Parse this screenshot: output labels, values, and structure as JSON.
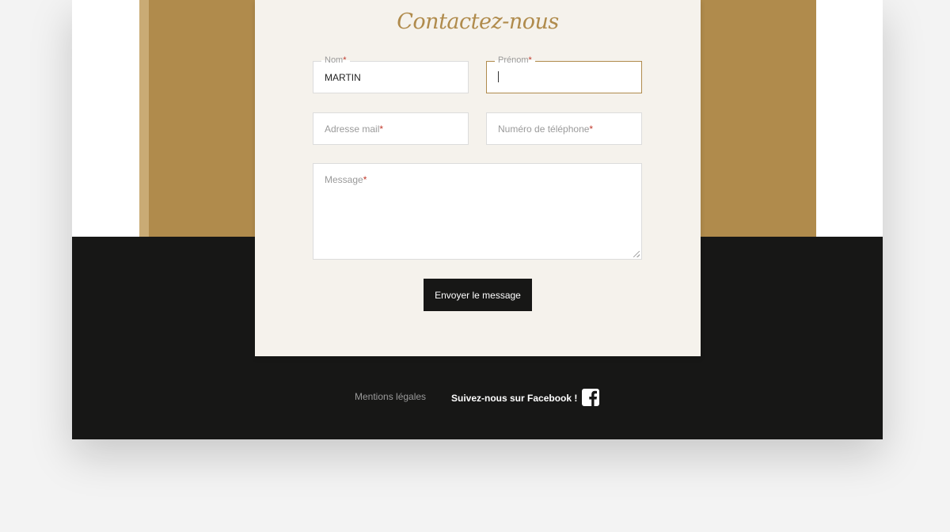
{
  "contact": {
    "title": "Contactez-nous",
    "required_marker": "*",
    "fields": {
      "nom": {
        "label": "Nom",
        "value": "MARTIN"
      },
      "prenom": {
        "label": "Prénom",
        "value": ""
      },
      "email": {
        "label": "Adresse mail",
        "placeholder": ""
      },
      "phone": {
        "label": "Numéro de téléphone",
        "placeholder": ""
      },
      "message": {
        "label": "Message",
        "placeholder": ""
      }
    },
    "submit_label": "Envoyer le message"
  },
  "footer": {
    "legal_link": "Mentions légales",
    "facebook_text": "Suivez-nous sur Facebook !",
    "facebook_icon": "facebook-icon"
  },
  "colors": {
    "accent_gold": "#b08b4c",
    "card_bg": "#f5f2ec",
    "footer_bg": "#171716",
    "required": "#c0392b"
  }
}
